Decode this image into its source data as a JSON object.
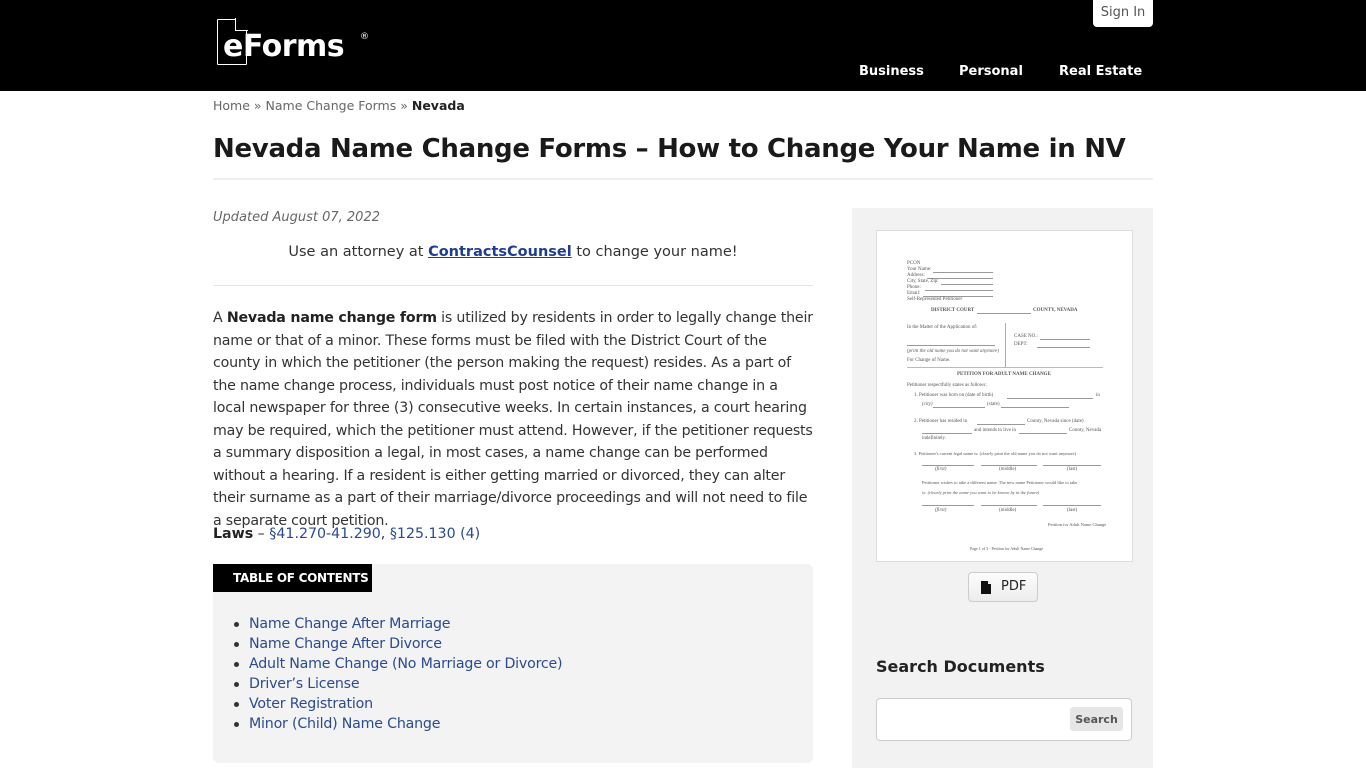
{
  "header": {
    "logo_text": "eForms",
    "logo_reg": "®",
    "sign_in": "Sign In",
    "nav": [
      {
        "label": "Business"
      },
      {
        "label": "Personal"
      },
      {
        "label": "Real Estate"
      }
    ]
  },
  "breadcrumb": {
    "home": "Home",
    "sep1": "»",
    "parent": "Name Change Forms",
    "sep2": "»",
    "current": "Nevada"
  },
  "page": {
    "title": "Nevada Name Change Forms – How to Change Your Name in NV",
    "updated": "Updated August 07, 2022",
    "promo": {
      "prefix": "Use an attorney at ",
      "link": "ContractsCounsel",
      "suffix": " to change your name!"
    },
    "intro": {
      "prefix": "A ",
      "bold": "Nevada name change form",
      "rest": " is utilized by residents in order to legally change their name or that of a minor. These forms must be filed with the District Court of the county in which the petitioner (the person making the request) resides. As a part of the name change process, individuals must post notice of their name change in a local newspaper for three (3) consecutive weeks. In certain instances, a court hearing may be required, which the petitioner must attend. However, if the petitioner requests a summary disposition a legal, in most cases, a name change can be performed without a hearing. If a resident is either getting married or divorced, they can alter their surname as a part of their marriage/divorce proceedings and will not need to file a separate court petition."
    },
    "laws": {
      "label": "Laws",
      "dash": " – ",
      "link1": "§41.270-41.290",
      "comma": ", ",
      "link2": "§125.130 (4)"
    },
    "toc": {
      "header": "TABLE OF CONTENTS",
      "items": [
        "Name Change After Marriage",
        "Name Change After Divorce",
        "Adult Name Change (No Marriage or Divorce)",
        "Driver’s License",
        "Voter Registration",
        "Minor (Child) Name Change"
      ]
    }
  },
  "sidebar": {
    "preview": {
      "lines": {
        "pcon": "PCON",
        "your_name": "Your Name:",
        "address": "Address:",
        "city": "City, State, Zip:",
        "phone": "Phone:",
        "email": "Email:",
        "self_rep": "Self-Represented Petitioner",
        "court_left": "DISTRICT COURT",
        "court_right": "COUNTY, NEVADA",
        "matter": "In the Matter of the Application of:",
        "case_no": "CASE NO.:",
        "dept": "DEPT:",
        "print_old": "(print the old name you do not want anymore)",
        "for_change": "For Change of Name.",
        "petition_title": "PETITION FOR ADULT NAME CHANGE",
        "states": "Petitioner respectfully states as follows:",
        "item1a": "1.  Petitioner was born on (date of birth)",
        "item1a_end": "in",
        "item1b": "(city)",
        "item1b_state": "(state)",
        "item2a": "2.  Petitioner has resided in",
        "item2a_mid": "County, Nevada since (date)",
        "item2b": "and intends to live in",
        "item2b_end": "County, Nevada",
        "item2c": "indefinitely.",
        "item3": "3.  Petitioner's current legal name is: (clearly print the old name you do not want anymore)",
        "first": "(first)",
        "middle": "(middle)",
        "last": "(last)",
        "wishes1": "Petitioner wishes to take a different name.  The new name Petitioner would like to take",
        "wishes2": "is: (clearly print the name you want to be known by in the future)",
        "footer_right": "Petition for Adult Name Change",
        "footer_page": "Page 1 of 3 - Petition for Adult Name Change"
      }
    },
    "pdf_button": "PDF",
    "search_title": "Search Documents",
    "search_input_value": "",
    "search_placeholder": "",
    "search_button": "Search"
  }
}
